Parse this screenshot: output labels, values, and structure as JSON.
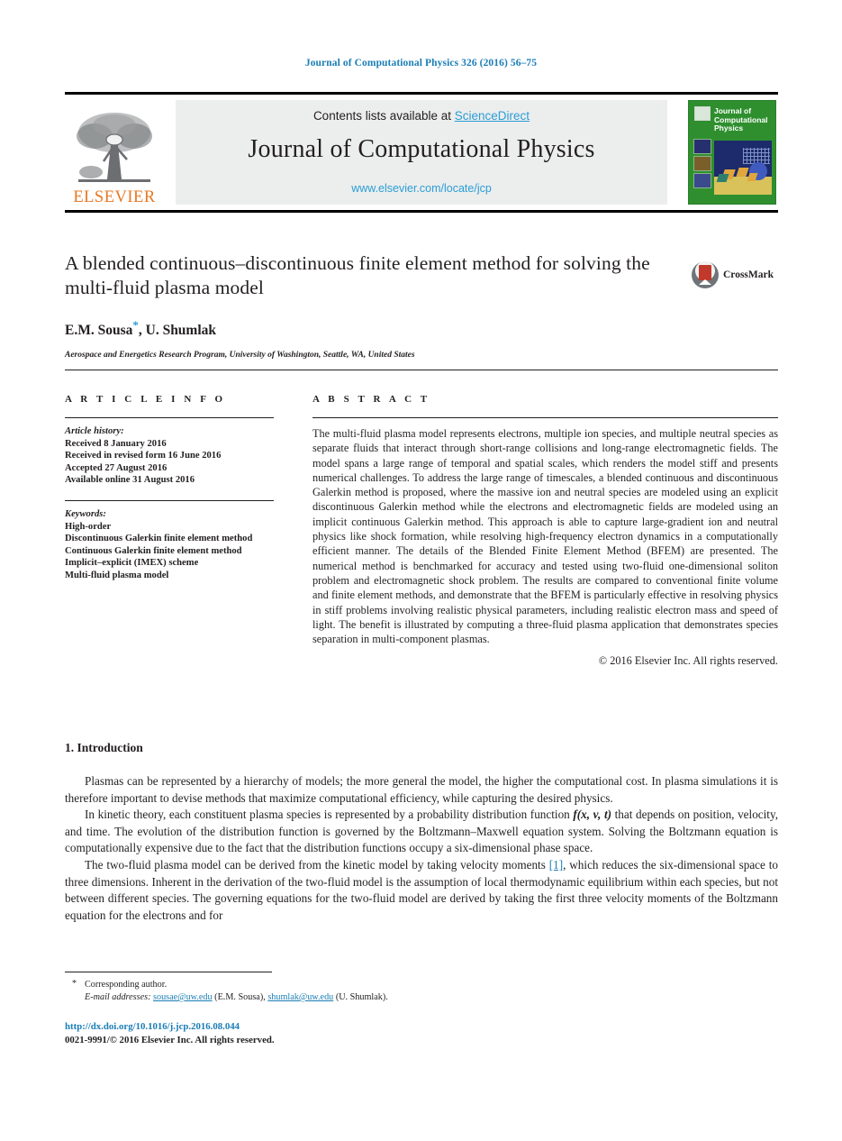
{
  "running_head": "Journal of Computational Physics 326 (2016) 56–75",
  "masthead": {
    "contents_prefix": "Contents lists available at ",
    "sciencedirect": "ScienceDirect",
    "journal_title": "Journal of Computational Physics",
    "journal_url": "www.elsevier.com/locate/jcp",
    "publisher_logo_text": "ELSEVIER",
    "cover_title": "Journal of Computational Physics"
  },
  "article": {
    "title": "A blended continuous–discontinuous finite element method for solving the multi-fluid plasma model",
    "authors": "E.M. Sousa",
    "authors_tail": ", U. Shumlak",
    "corresponding_marker": "*",
    "affiliation": "Aerospace and Energetics Research Program, University of Washington, Seattle, WA, United States",
    "crossmark_label": "CrossMark"
  },
  "info": {
    "heading": "A R T I C L E   I N F O",
    "history_heading": "Article history:",
    "history": [
      "Received 8 January 2016",
      "Received in revised form 16 June 2016",
      "Accepted 27 August 2016",
      "Available online 31 August 2016"
    ],
    "keywords_heading": "Keywords:",
    "keywords": [
      "High-order",
      "Discontinuous Galerkin finite element method",
      "Continuous Galerkin finite element method",
      "Implicit–explicit (IMEX) scheme",
      "Multi-fluid plasma model"
    ]
  },
  "abstract": {
    "heading": "A B S T R A C T",
    "text": "The multi-fluid plasma model represents electrons, multiple ion species, and multiple neutral species as separate fluids that interact through short-range collisions and long-range electromagnetic fields. The model spans a large range of temporal and spatial scales, which renders the model stiff and presents numerical challenges. To address the large range of timescales, a blended continuous and discontinuous Galerkin method is proposed, where the massive ion and neutral species are modeled using an explicit discontinuous Galerkin method while the electrons and electromagnetic fields are modeled using an implicit continuous Galerkin method. This approach is able to capture large-gradient ion and neutral physics like shock formation, while resolving high-frequency electron dynamics in a computationally efficient manner. The details of the Blended Finite Element Method (BFEM) are presented. The numerical method is benchmarked for accuracy and tested using two-fluid one-dimensional soliton problem and electromagnetic shock problem. The results are compared to conventional finite volume and finite element methods, and demonstrate that the BFEM is particularly effective in resolving physics in stiff problems involving realistic physical parameters, including realistic electron mass and speed of light. The benefit is illustrated by computing a three-fluid plasma application that demonstrates species separation in multi-component plasmas.",
    "copyright": "© 2016 Elsevier Inc. All rights reserved."
  },
  "body": {
    "section_number_title": "1. Introduction",
    "paragraph_1": "Plasmas can be represented by a hierarchy of models; the more general the model, the higher the computational cost. In plasma simulations it is therefore important to devise methods that maximize computational efficiency, while capturing the desired physics.",
    "paragraph_2_a": "In kinetic theory, each constituent plasma species is represented by a probability distribution function ",
    "paragraph_2_math": "f(x, v, t)",
    "paragraph_2_b": " that depends on position, velocity, and time. The evolution of the distribution function is governed by the Boltzmann–Maxwell equation system. Solving the Boltzmann equation is computationally expensive due to the fact that the distribution functions occupy a six-dimensional phase space.",
    "paragraph_3_a": "The two-fluid plasma model can be derived from the kinetic model by taking velocity moments ",
    "paragraph_3_cite": "[1]",
    "paragraph_3_b": ", which reduces the six-dimensional space to three dimensions. Inherent in the derivation of the two-fluid model is the assumption of local thermodynamic equilibrium within each species, but not between different species. The governing equations for the two-fluid model are derived by taking the first three velocity moments of the Boltzmann equation for the electrons and for"
  },
  "footer": {
    "corresponding_author": "Corresponding author.",
    "email_label": "E-mail addresses:",
    "email_1": "sousae@uw.edu",
    "email_1_owner": "(E.M. Sousa),",
    "email_2": "shumlak@uw.edu",
    "email_2_owner": "(U. Shumlak).",
    "doi": "http://dx.doi.org/10.1016/j.jcp.2016.08.044",
    "issn_line": "0021-9991/© 2016 Elsevier Inc. All rights reserved."
  },
  "colors": {
    "link_blue": "#1a7db6",
    "sciencedirect_blue": "#2a9fd6",
    "elsevier_orange": "#E87722",
    "cover_green": "#2f8f2f"
  }
}
